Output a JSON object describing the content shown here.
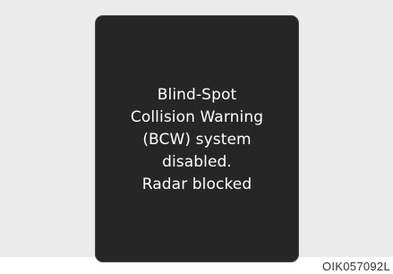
{
  "display": {
    "message_lines": [
      "Blind-Spot",
      "Collision Warning",
      "(BCW) system",
      "disabled.",
      "Radar blocked"
    ]
  },
  "figure": {
    "code": "OIK057092L"
  },
  "colors": {
    "background": "#ebebeb",
    "screen": "#262626",
    "text": "#ffffff"
  }
}
